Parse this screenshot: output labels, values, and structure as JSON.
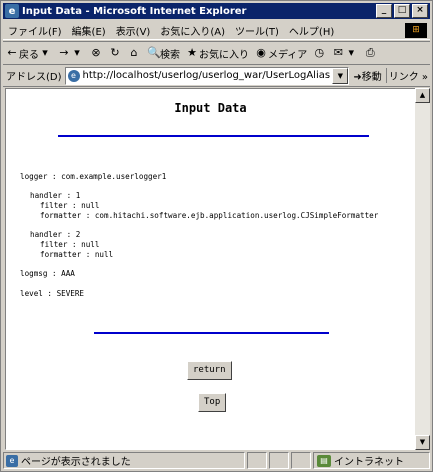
{
  "window": {
    "title": "Input Data - Microsoft Internet Explorer",
    "app_icon": "ie-icon",
    "controls": {
      "minimize": "_",
      "maximize": "□",
      "close": "×"
    }
  },
  "menubar": {
    "items": [
      "ファイル(F)",
      "編集(E)",
      "表示(V)",
      "お気に入り(A)",
      "ツール(T)",
      "ヘルプ(H)"
    ]
  },
  "toolbar": {
    "back": "戻る",
    "search": "検索",
    "favorites": "お気に入り",
    "media": "メディア",
    "icons": {
      "back": "←",
      "forward": "→",
      "stop": "⊗",
      "refresh": "↻",
      "home": "⌂",
      "search": "🔍",
      "history": "◷",
      "mail": "✉",
      "print": "⎙"
    }
  },
  "addressbar": {
    "label": "アドレス(D)",
    "url": "http://localhost/userlog/userlog_war/UserLogAlias",
    "go": "移動",
    "links": "リンク »"
  },
  "page": {
    "title": "Input Data",
    "lines": {
      "logger": "logger : com.example.userlogger1",
      "handler1": "handler : 1",
      "handler1_filter": "filter : null",
      "handler1_formatter": "formatter : com.hitachi.software.ejb.application.userlog.CJSimpleFormatter",
      "handler2": "handler : 2",
      "handler2_filter": "filter : null",
      "handler2_formatter": "formatter : null",
      "logmsg": "logmsg : AAA",
      "level": "level : SEVERE"
    },
    "buttons": {
      "return": "return",
      "top": "Top"
    }
  },
  "statusbar": {
    "message": "ページが表示されました",
    "zone": "イントラネット"
  }
}
